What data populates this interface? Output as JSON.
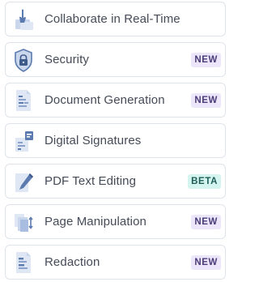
{
  "colors": {
    "icon_blue": "#5b7bb0",
    "icon_light": "#c9d6ec",
    "new_badge_bg": "#ece6fb",
    "beta_badge_bg": "#d4f4ef"
  },
  "features": [
    {
      "label": "Collaborate in Real-Time",
      "icon": "collaborate-icon",
      "badge": ""
    },
    {
      "label": "Security",
      "icon": "shield-lock-icon",
      "badge": "NEW"
    },
    {
      "label": "Document Generation",
      "icon": "document-icon",
      "badge": "NEW"
    },
    {
      "label": "Digital Signatures",
      "icon": "signature-icon",
      "badge": ""
    },
    {
      "label": "PDF Text Editing",
      "icon": "pencil-icon",
      "badge": "BETA"
    },
    {
      "label": "Page Manipulation",
      "icon": "pages-icon",
      "badge": "NEW"
    },
    {
      "label": "Redaction",
      "icon": "redaction-icon",
      "badge": "NEW"
    }
  ]
}
